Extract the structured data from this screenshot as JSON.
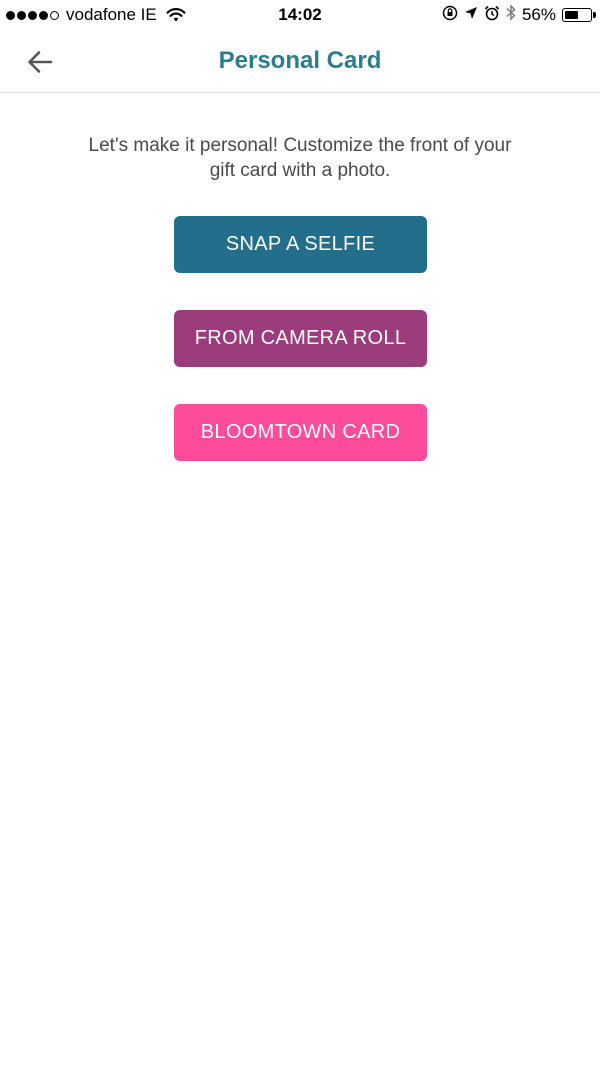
{
  "status_bar": {
    "carrier": "vodafone IE",
    "time": "14:02",
    "battery_percent": "56%",
    "battery_level": 0.56,
    "signal_bars_filled": 4,
    "signal_bars_total": 5,
    "icons": [
      "wifi-icon",
      "orientation-lock-icon",
      "location-arrow-icon",
      "alarm-icon",
      "bluetooth-icon",
      "battery-icon"
    ]
  },
  "nav": {
    "title": "Personal Card",
    "back_icon": "arrow-left-icon",
    "title_color": "#2d7d8a"
  },
  "main": {
    "intro_text": "Let's make it personal! Customize the front of your gift card with a photo.",
    "buttons": [
      {
        "label": "SNAP A SELFIE",
        "color": "#236e8b"
      },
      {
        "label": "FROM CAMERA ROLL",
        "color": "#9b3c7d"
      },
      {
        "label": "BLOOMTOWN CARD",
        "color": "#fe4c9b"
      }
    ]
  }
}
